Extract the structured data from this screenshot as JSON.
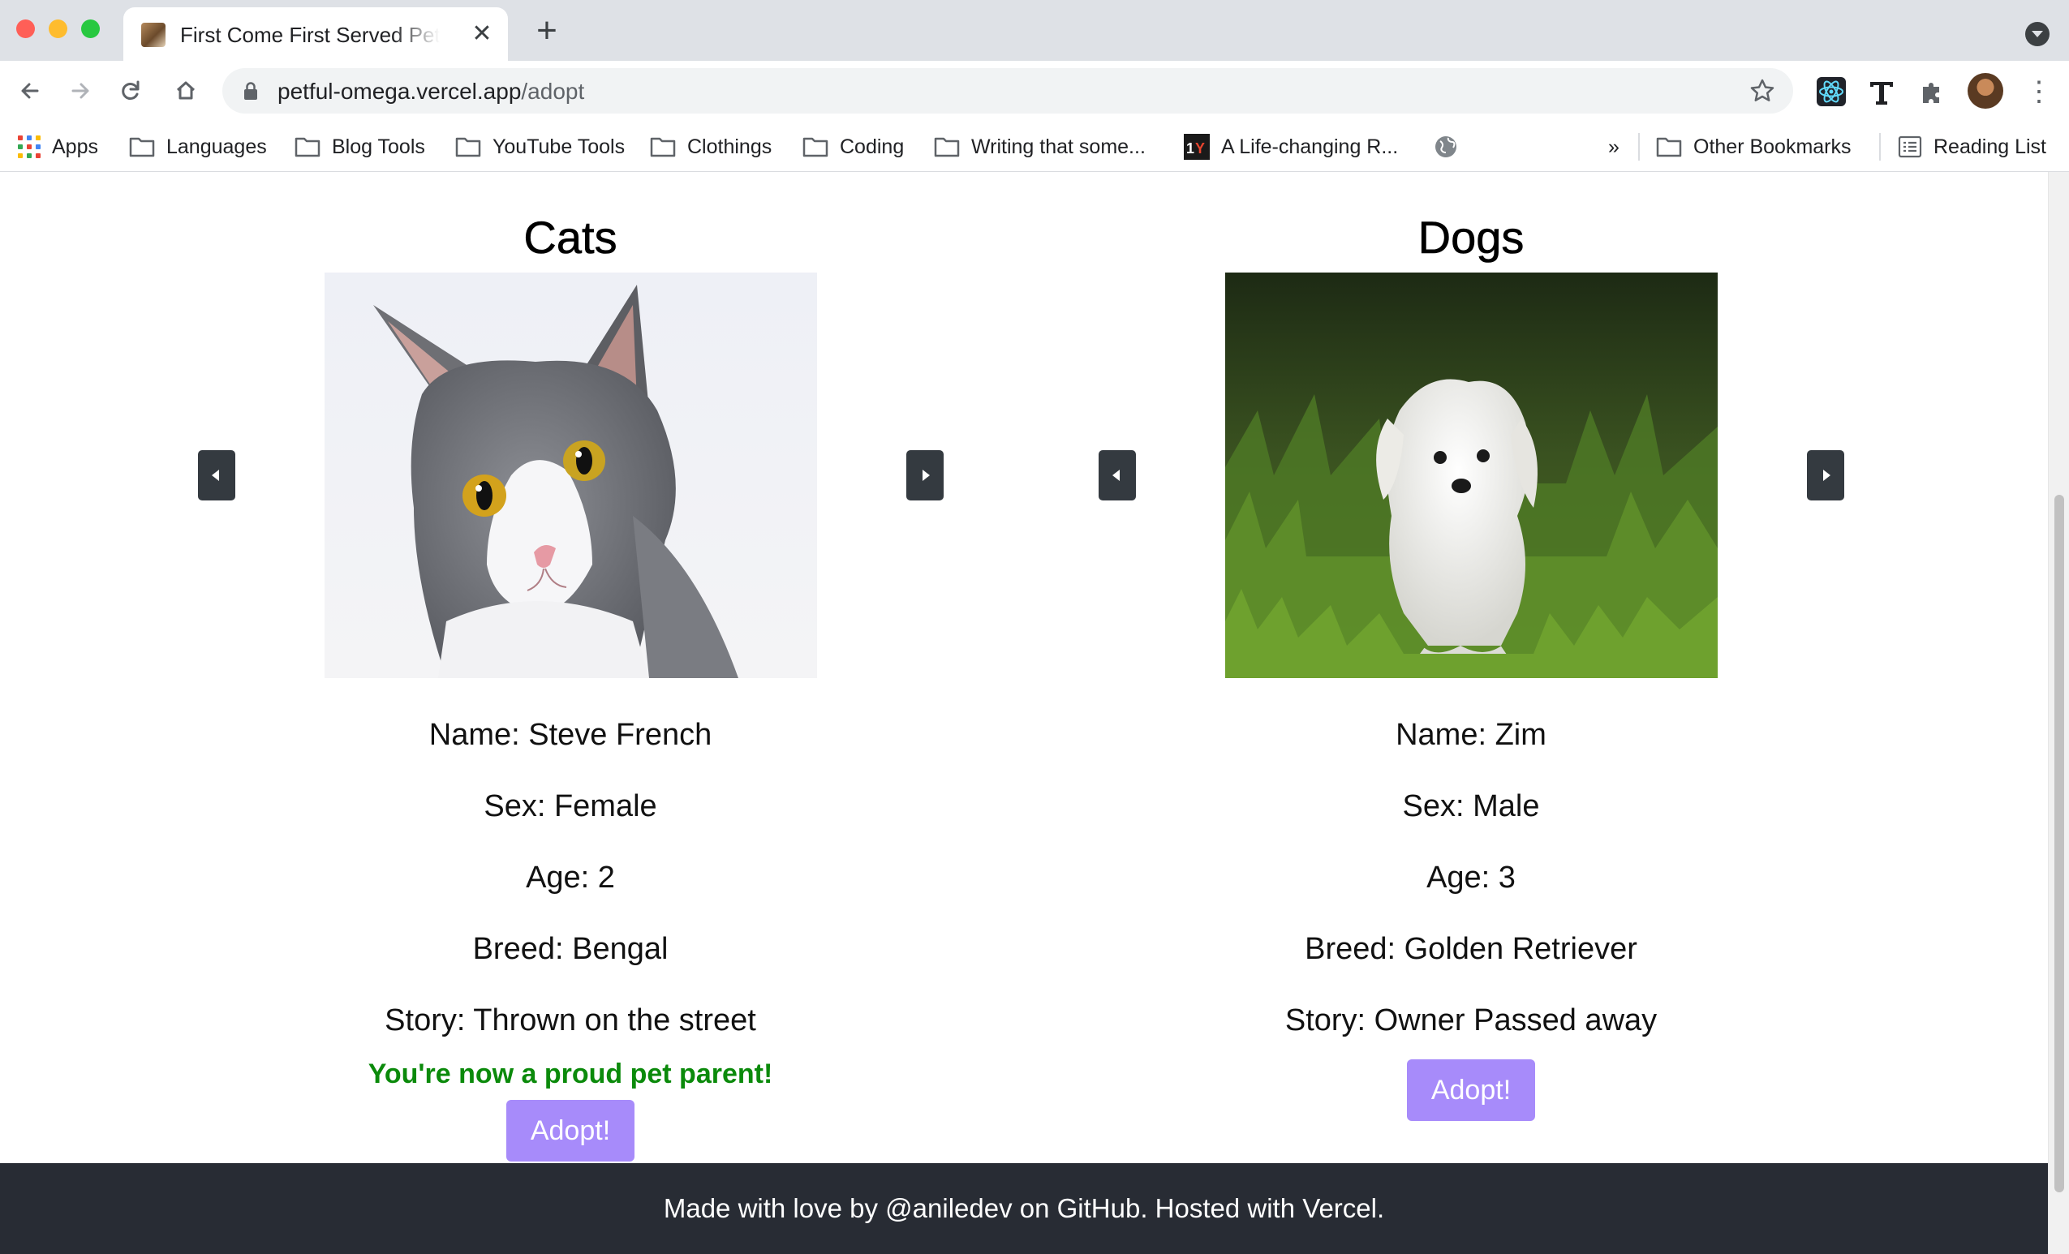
{
  "browser": {
    "tab_title": "First Come First Served Pet Adoption",
    "new_tab_label": "+",
    "url_host": "petful-omega.vercel.app",
    "url_path": "/adopt",
    "bookmarks": {
      "apps": "Apps",
      "languages": "Languages",
      "blog_tools": "Blog Tools",
      "youtube_tools": "YouTube Tools",
      "clothings": "Clothings",
      "coding": "Coding",
      "writing": "Writing that some...",
      "life_changing": "A Life-changing R...",
      "overflow": "»",
      "other_bookmarks": "Other Bookmarks",
      "reading_list": "Reading List"
    }
  },
  "cats": {
    "heading": "Cats",
    "name": "Name: Steve French",
    "sex": "Sex: Female",
    "age": "Age: 2",
    "breed": "Breed: Bengal",
    "story": "Story: Thrown on the street",
    "success": "You're now a proud pet parent!",
    "adopt_label": "Adopt!"
  },
  "dogs": {
    "heading": "Dogs",
    "name": "Name: Zim",
    "sex": "Sex: Male",
    "age": "Age: 3",
    "breed": "Breed: Golden Retriever",
    "story": "Story: Owner Passed away",
    "adopt_label": "Adopt!"
  },
  "footer": {
    "text": "Made with love by @aniledev on GitHub. Hosted with Vercel."
  },
  "colors": {
    "adopt_button": "#a78bfa",
    "success_text": "#0b8a0b",
    "footer_bg": "#282c34",
    "carousel_arrow": "#343a40"
  }
}
